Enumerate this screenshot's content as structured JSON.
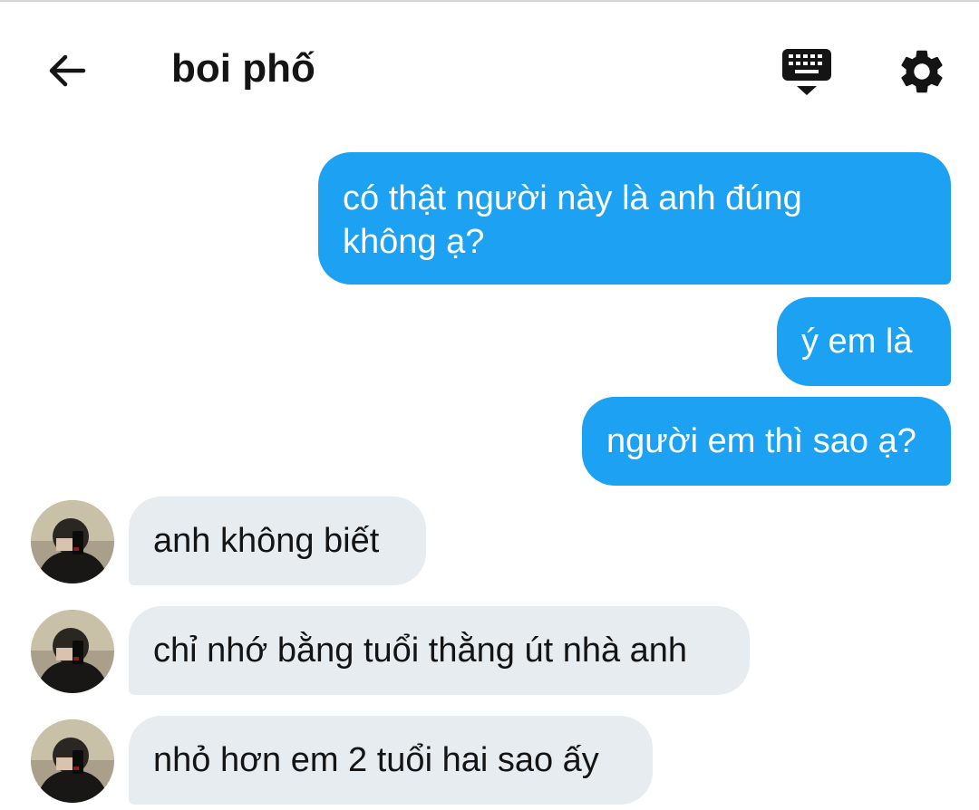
{
  "header": {
    "title": "boi phố",
    "back_icon": "arrow-left-icon",
    "keyboard_icon": "keyboard-hide-icon",
    "settings_icon": "gear-icon"
  },
  "colors": {
    "outgoing_bubble": "#1da1f2",
    "incoming_bubble": "#e6ecf0",
    "text_dark": "#141414"
  },
  "messages": [
    {
      "direction": "outgoing",
      "lines": [
        "có thật người này là anh đúng",
        "không ạ?"
      ]
    },
    {
      "direction": "outgoing",
      "lines": [
        "ý em là"
      ]
    },
    {
      "direction": "outgoing",
      "lines": [
        "người em thì sao ạ?"
      ]
    },
    {
      "direction": "incoming",
      "lines": [
        "anh không biết"
      ]
    },
    {
      "direction": "incoming",
      "lines": [
        "chỉ nhớ bằng tuổi thằng út nhà anh"
      ]
    },
    {
      "direction": "incoming",
      "lines": [
        "nhỏ hơn em 2 tuổi hai sao ấy"
      ]
    }
  ]
}
